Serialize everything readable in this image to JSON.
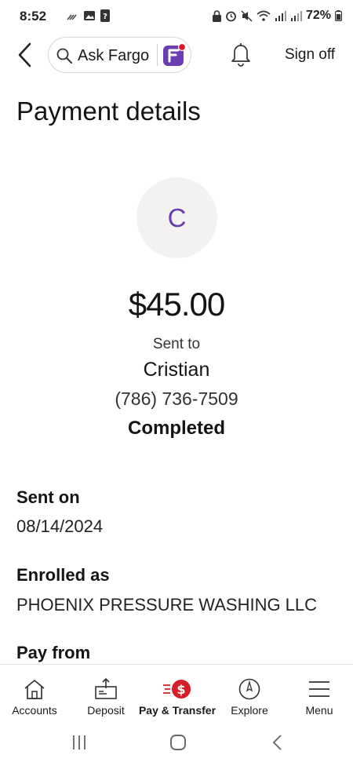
{
  "status_bar": {
    "time": "8:52",
    "battery": "72%",
    "left_icons": [
      "missed-call-icon",
      "image-icon",
      "notification-icon"
    ],
    "right_icons": [
      "lock-icon",
      "alarm-icon",
      "mute-icon",
      "wifi-icon",
      "signal-icon",
      "signal-icon",
      "battery-icon"
    ]
  },
  "header": {
    "search_label": "Ask Fargo",
    "sign_off": "Sign off",
    "brand_color": "#d71e28",
    "accent_color": "#6a3db1"
  },
  "page": {
    "title": "Payment details"
  },
  "payment": {
    "avatar_initial": "C",
    "amount": "$45.00",
    "sent_to_label": "Sent to",
    "recipient_name": "Cristian",
    "recipient_phone": "(786) 736-7509",
    "status": "Completed"
  },
  "details": {
    "sent_on_label": "Sent on",
    "sent_on_value": "08/14/2024",
    "enrolled_as_label": "Enrolled as",
    "enrolled_as_value": "PHOENIX PRESSURE WASHING LLC",
    "pay_from_label": "Pay from"
  },
  "bottom_nav": {
    "items": [
      {
        "label": "Accounts",
        "icon": "house-icon"
      },
      {
        "label": "Deposit",
        "icon": "check-deposit-icon"
      },
      {
        "label": "Pay & Transfer",
        "icon": "dollar-send-icon",
        "active": true
      },
      {
        "label": "Explore",
        "icon": "compass-icon"
      },
      {
        "label": "Menu",
        "icon": "hamburger-icon"
      }
    ]
  },
  "system_nav": {
    "buttons": [
      "recents-icon",
      "home-icon",
      "back-icon"
    ]
  }
}
